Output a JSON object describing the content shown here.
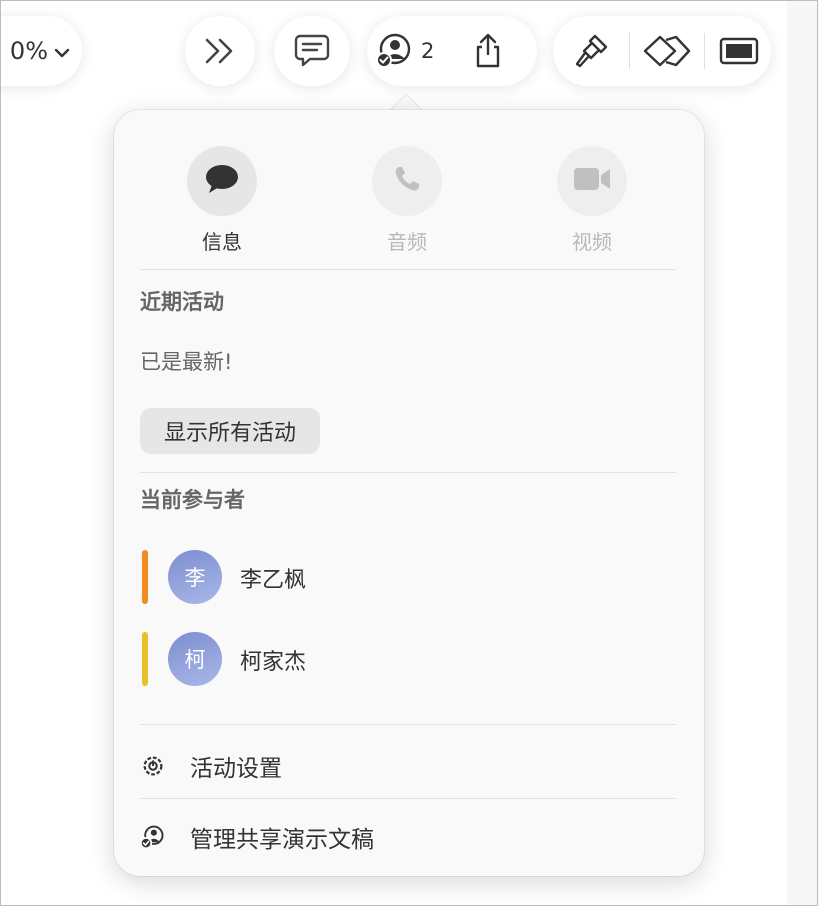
{
  "toolbar": {
    "zoom_value": "0%",
    "collaborators_count": "2"
  },
  "popover": {
    "communication": [
      {
        "label": "信息",
        "enabled": true,
        "icon": "message-bubble-icon"
      },
      {
        "label": "音频",
        "enabled": false,
        "icon": "phone-icon"
      },
      {
        "label": "视频",
        "enabled": false,
        "icon": "video-camera-icon"
      }
    ],
    "recent_activity": {
      "title": "近期活动",
      "status": "已是最新!",
      "show_all_label": "显示所有活动"
    },
    "participants": {
      "title": "当前参与者",
      "items": [
        {
          "avatar_text": "李",
          "name": "李乙枫",
          "color": "#f28c22"
        },
        {
          "avatar_text": "柯",
          "name": "柯家杰",
          "color": "#e6c12a"
        }
      ]
    },
    "menu": [
      {
        "label": "活动设置",
        "icon": "activity-settings-icon"
      },
      {
        "label": "管理共享演示文稿",
        "icon": "manage-collaboration-icon"
      }
    ]
  }
}
